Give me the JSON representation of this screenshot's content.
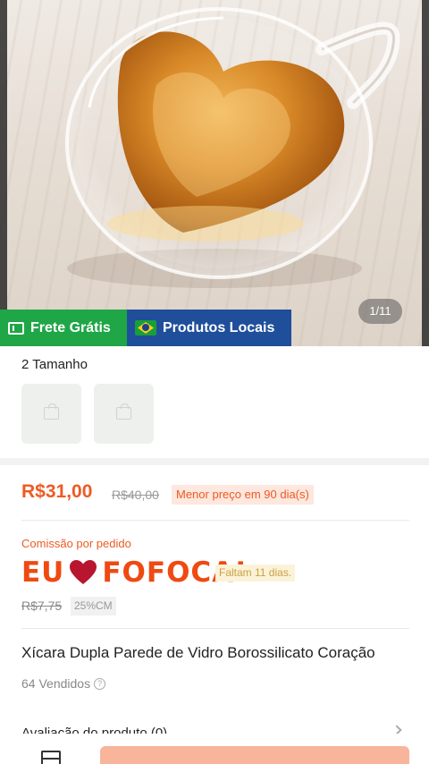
{
  "gallery": {
    "counter": "1/11",
    "badges": {
      "free_shipping": "Frete Grátis",
      "local_products": "Produtos Locais"
    }
  },
  "variants": {
    "label": "2 Tamanho",
    "options_count": 2
  },
  "pricing": {
    "price": "R$31,00",
    "original_price": "R$40,00",
    "lowest_tag": "Menor preço em 90 dia(s)"
  },
  "commission": {
    "label": "Comissão por pedido",
    "overlay_left": "EU",
    "overlay_right": "FOFOCA!",
    "days_left": "Faltam 11 dias.",
    "old_value": "R$7,75",
    "rate": "25%CM"
  },
  "product": {
    "title": "Xícara Dupla Parede de Vidro Borossilicato Coração",
    "sold": "64 Vendidos"
  },
  "reviews": {
    "label": "Avaliação do produto (0)"
  },
  "colors": {
    "accent": "#ee5a24",
    "free_shipping_bg": "#1fa647",
    "local_bg": "#1f4f9a",
    "cta": "#f8b59c"
  }
}
